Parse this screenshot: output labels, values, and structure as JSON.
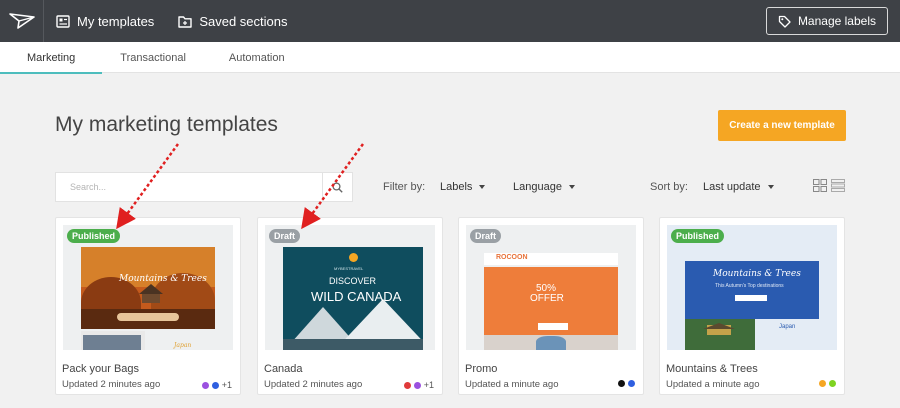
{
  "topbar": {
    "nav": [
      {
        "label": "My templates",
        "icon": "templates-icon"
      },
      {
        "label": "Saved sections",
        "icon": "folder-icon"
      }
    ],
    "manage_labels": "Manage labels"
  },
  "tabs": [
    {
      "label": "Marketing",
      "active": true
    },
    {
      "label": "Transactional",
      "active": false
    },
    {
      "label": "Automation",
      "active": false
    }
  ],
  "page": {
    "title": "My marketing templates",
    "create_button": "Create a new template"
  },
  "filters": {
    "search_placeholder": "Search...",
    "filter_by": "Filter by:",
    "labels": "Labels",
    "language": "Language",
    "sort_by": "Sort by:",
    "sort_value": "Last update"
  },
  "colors": {
    "accent": "#f5a623",
    "tab_active": "#4dbdbd",
    "published": "#4cae4c",
    "draft": "#9aa0a5",
    "annotation_arrow": "#e02020"
  },
  "cards": [
    {
      "status": "Published",
      "name": "Pack your Bags",
      "updated": "Updated 2 minutes ago",
      "label_colors": [
        "#9b51e0",
        "#2f5fe0"
      ],
      "extra_labels": "+1",
      "thumb_text": {
        "title": "Mountains & Trees",
        "script_footer": "Japan"
      }
    },
    {
      "status": "Draft",
      "name": "Canada",
      "updated": "Updated 2 minutes ago",
      "label_colors": [
        "#e03a3a",
        "#9b51e0"
      ],
      "extra_labels": "+1",
      "thumb_text": {
        "brand": "MYBESTRAVEL",
        "line1": "DISCOVER",
        "line2": "WILD CANADA"
      }
    },
    {
      "status": "Draft",
      "name": "Promo",
      "updated": "Updated a minute ago",
      "label_colors": [
        "#111111",
        "#2f5fe0"
      ],
      "extra_labels": "",
      "thumb_text": {
        "brand": "ROCOON",
        "line1": "50%",
        "line2": "OFFER"
      }
    },
    {
      "status": "Published",
      "name": "Mountains & Trees",
      "updated": "Updated a minute ago",
      "label_colors": [
        "#f5a623",
        "#7ed321"
      ],
      "extra_labels": "",
      "thumb_text": {
        "title": "Mountains & Trees",
        "sub": "This Autumn's Top destinations",
        "side": "Japan"
      }
    }
  ]
}
